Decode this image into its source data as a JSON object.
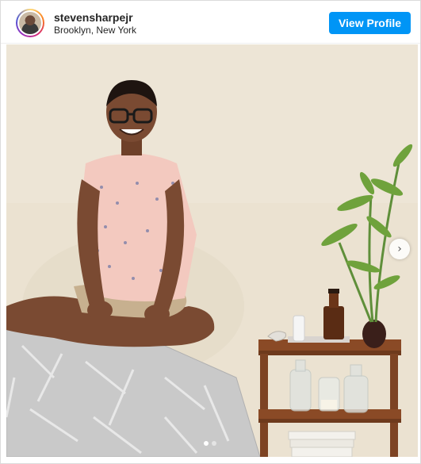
{
  "post": {
    "username": "stevensharpejr",
    "location": "Brooklyn, New York",
    "view_profile_label": "View Profile"
  },
  "carousel": {
    "total_slides": 2,
    "current_slide": 1
  },
  "icons": {
    "next": "chevron-right-icon",
    "avatar": "avatar"
  },
  "colors": {
    "accent": "#0095f6",
    "wall": "#ece3d3"
  }
}
